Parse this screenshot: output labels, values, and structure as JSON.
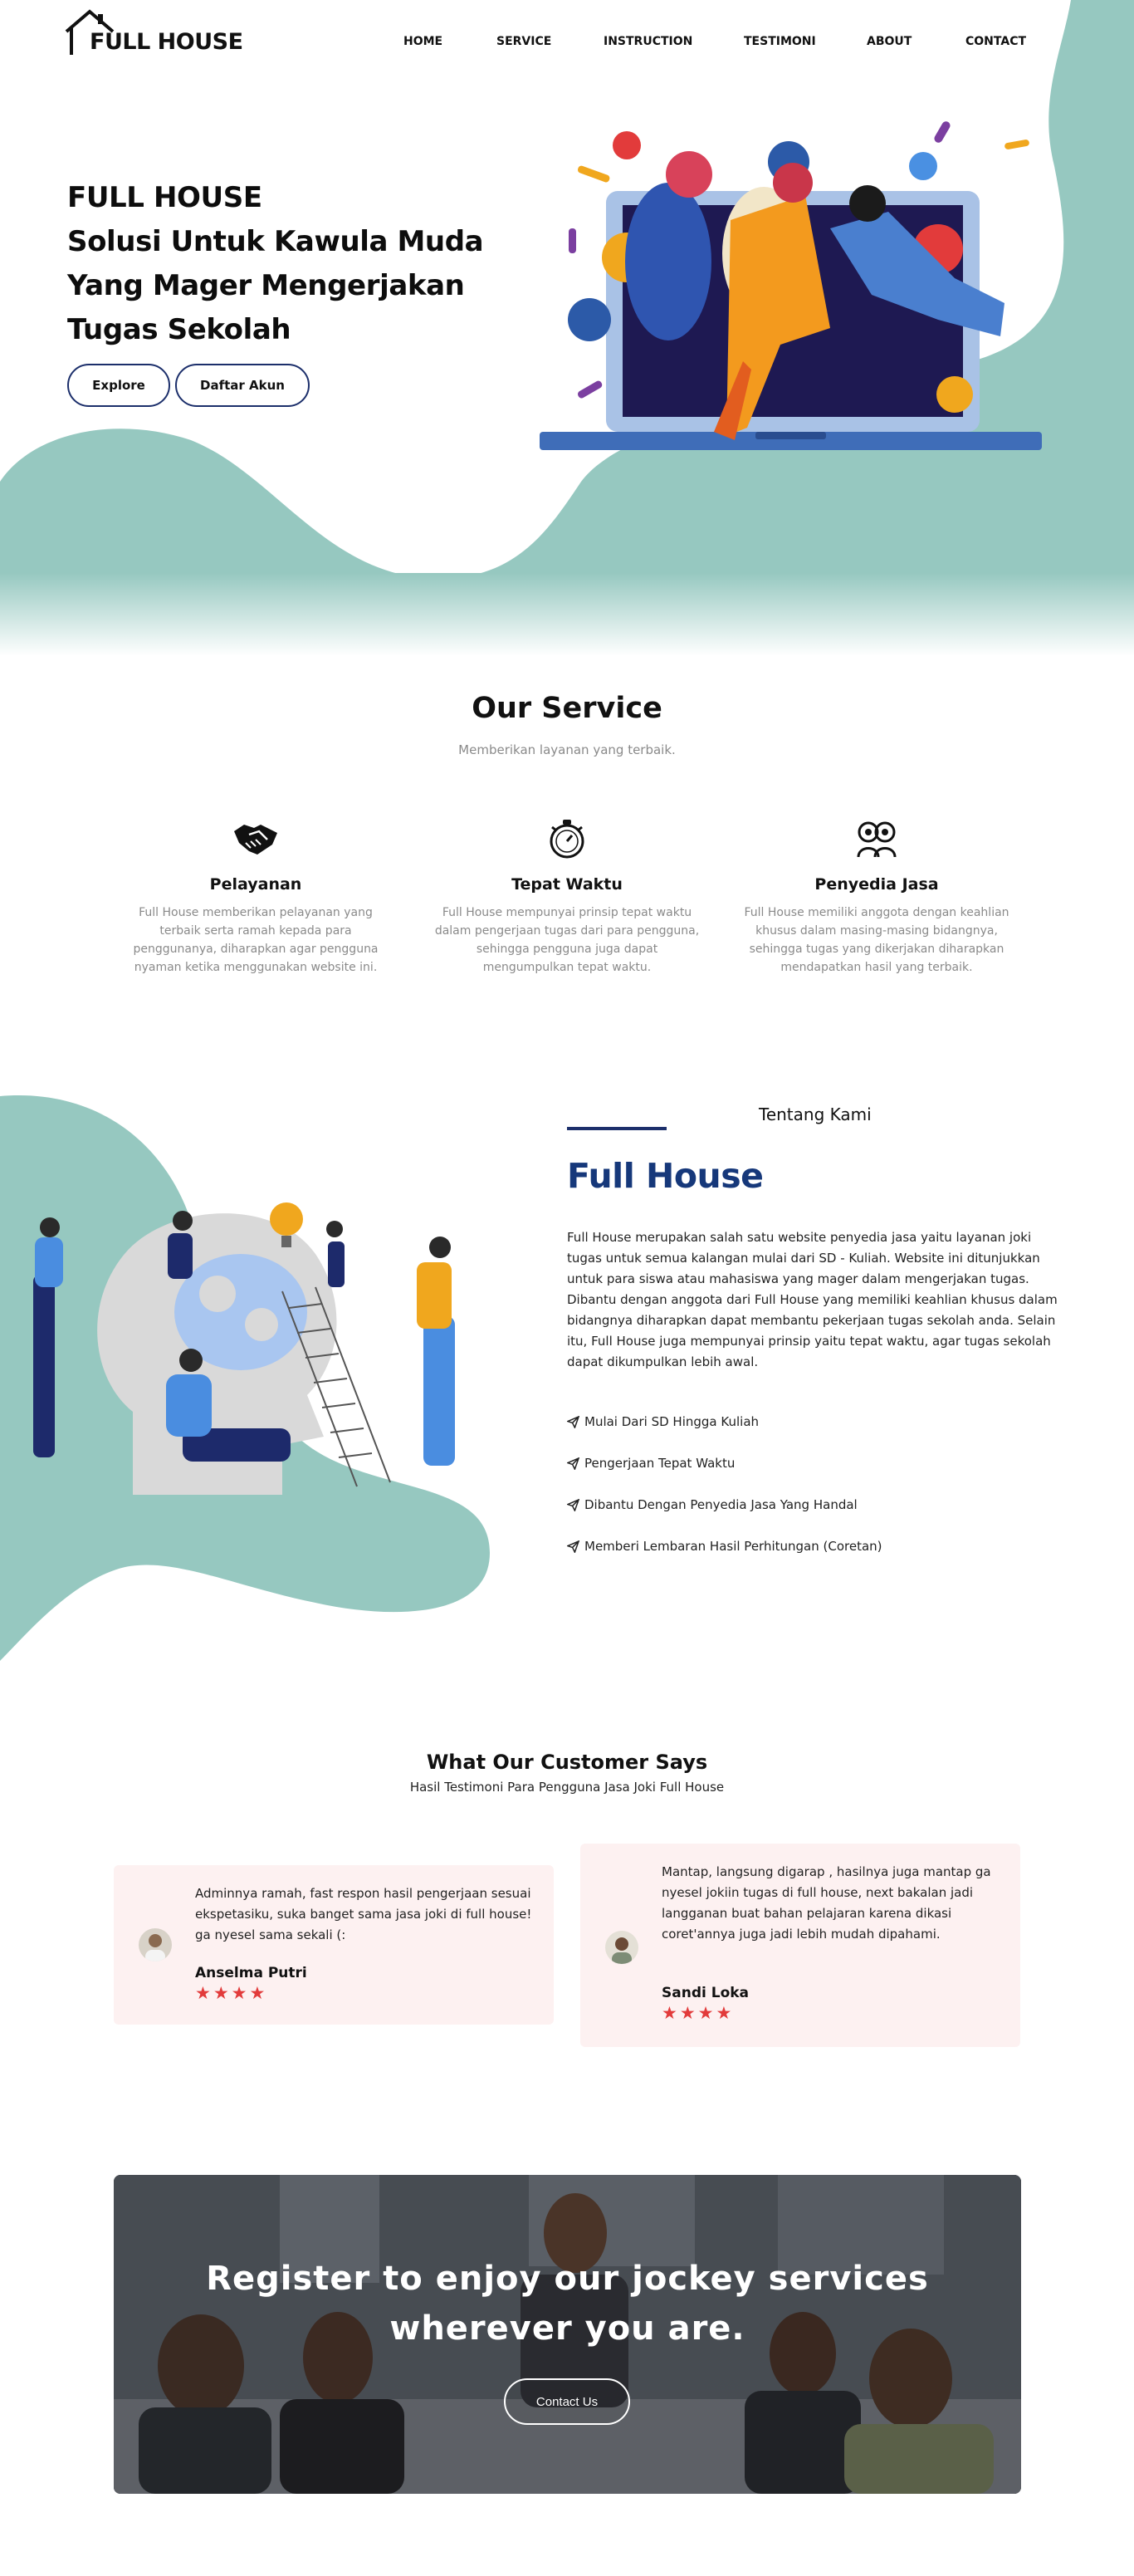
{
  "brand": {
    "name": "FULL HOUSE",
    "icon": "house-icon"
  },
  "nav": {
    "items": [
      "HOME",
      "SERVICE",
      "INSTRUCTION",
      "TESTIMONI",
      "ABOUT",
      "CONTACT"
    ]
  },
  "hero": {
    "line1": "FULL HOUSE",
    "line2": "Solusi Untuk Kawula Muda",
    "line3": "Yang Mager Mengerjakan",
    "line4": "Tugas Sekolah",
    "explore_label": "Explore",
    "register_label": "Daftar Akun"
  },
  "service": {
    "title": "Our Service",
    "subtitle": "Memberikan layanan yang terbaik.",
    "items": [
      {
        "icon": "handshake-icon",
        "title": "Pelayanan",
        "desc": "Full House memberikan pelayanan yang terbaik serta ramah kepada para penggunanya, diharapkan agar pengguna nyaman ketika menggunakan website ini."
      },
      {
        "icon": "stopwatch-icon",
        "title": "Tepat Waktu",
        "desc": "Full House mempunyai prinsip tepat waktu dalam pengerjaan tugas dari para pengguna, sehingga pengguna juga dapat mengumpulkan tepat waktu."
      },
      {
        "icon": "people-icon",
        "title": "Penyedia Jasa",
        "desc": "Full House memiliki anggota dengan keahlian khusus dalam masing-masing bidangnya, sehingga tugas yang dikerjakan diharapkan mendapatkan hasil yang terbaik."
      }
    ]
  },
  "about": {
    "kicker": "Tentang Kami",
    "title": "Full House",
    "body": "Full House merupakan salah satu website penyedia jasa yaitu layanan joki tugas untuk semua kalangan mulai dari SD - Kuliah. Website ini ditunjukkan untuk para siswa atau mahasiswa yang mager dalam mengerjakan tugas. Dibantu dengan anggota dari Full House yang memiliki keahlian khusus dalam bidangnya diharapkan dapat membantu pekerjaan tugas sekolah anda. Selain itu, Full House juga mempunyai prinsip yaitu tepat waktu, agar tugas sekolah dapat dikumpulkan lebih awal.",
    "points": [
      "Mulai Dari SD Hingga Kuliah",
      "Pengerjaan Tepat Waktu",
      "Dibantu Dengan Penyedia Jasa Yang Handal",
      "Memberi Lembaran Hasil Perhitungan (Coretan)"
    ]
  },
  "testimoni": {
    "title": "What Our Customer Says",
    "subtitle": "Hasil Testimoni Para Pengguna Jasa Joki Full House",
    "items": [
      {
        "text": "Adminnya ramah, fast respon hasil pengerjaan sesuai ekspetasiku, suka banget sama jasa joki di full house! ga nyesel sama sekali (:",
        "name": "Anselma Putri",
        "stars": "★★★★",
        "rating": 4
      },
      {
        "text": "Mantap, langsung digarap , hasilnya juga mantap ga nyesel jokiin tugas di full house, next bakalan jadi langganan buat bahan pelajaran karena dikasi coret'annya juga jadi lebih mudah dipahami.",
        "name": "Sandi Loka",
        "stars": "★★★★",
        "rating": 4
      }
    ]
  },
  "cta": {
    "line1": "Register to enjoy our jockey services",
    "line2": "wherever you are.",
    "button_label": "Contact Us"
  },
  "colors": {
    "teal": "#96c8c0",
    "navy": "#16387a",
    "star": "#e23b3b",
    "card": "#fdf1f1"
  }
}
